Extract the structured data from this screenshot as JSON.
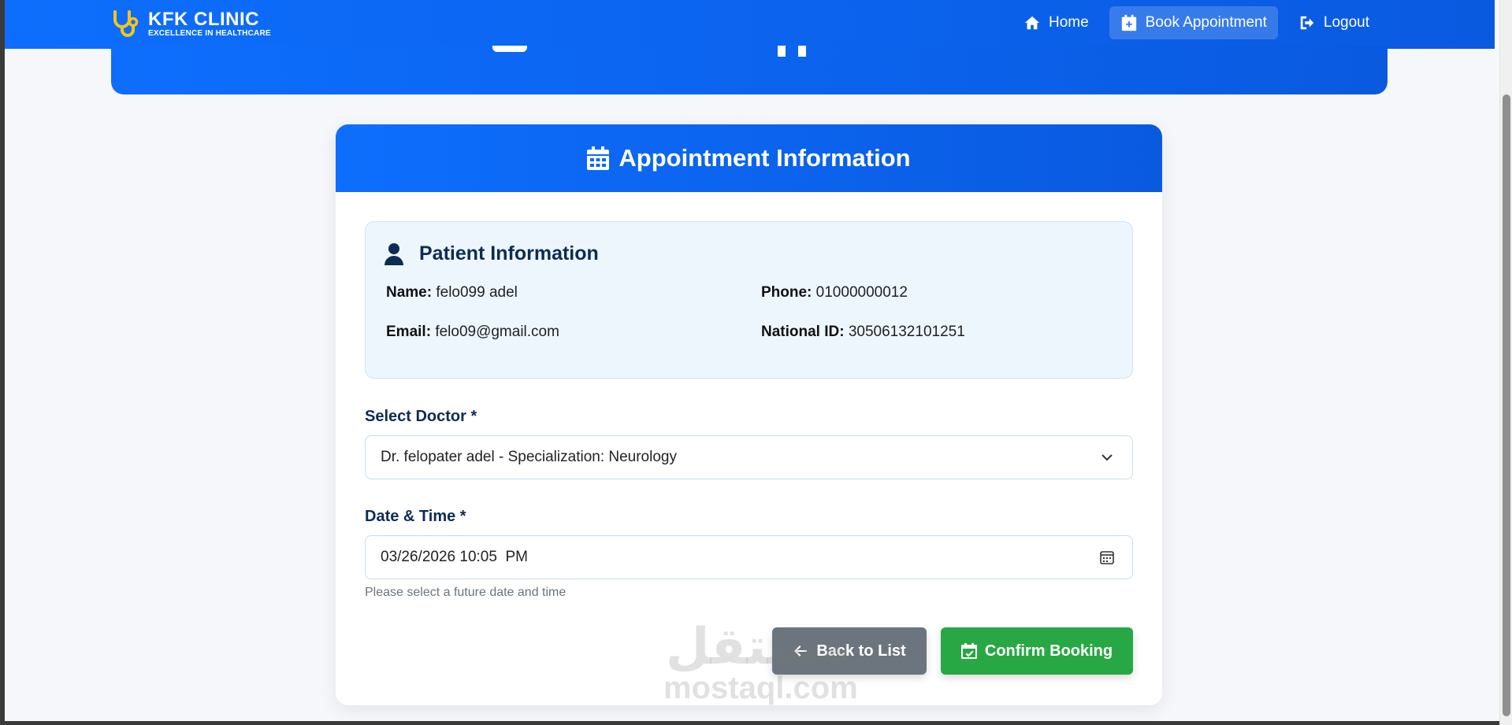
{
  "navbar": {
    "brand_name": "KFK CLINIC",
    "brand_tagline": "EXCELLENCE IN HEALTHCARE",
    "links": [
      {
        "label": "Home",
        "icon": "home-icon",
        "active": false
      },
      {
        "label": "Book Appointment",
        "icon": "calendar-plus-icon",
        "active": true
      },
      {
        "label": "Logout",
        "icon": "logout-icon",
        "active": false
      }
    ]
  },
  "card": {
    "title": "Appointment Information",
    "patient": {
      "title": "Patient Information",
      "name_label": "Name:",
      "name": "felo099 adel",
      "phone_label": "Phone:",
      "phone": "01000000012",
      "email_label": "Email:",
      "email": "felo09@gmail.com",
      "national_id_label": "National ID:",
      "national_id": "30506132101251"
    },
    "doctor_label": "Select Doctor *",
    "doctor_value": "Dr. felopater adel - Specialization: Neurology",
    "datetime_label": "Date & Time *",
    "datetime_value": "03/26/2026 10:05  PM",
    "datetime_hint": "Please select a future date and time",
    "back_label": "Back to List",
    "confirm_label": "Confirm Booking"
  },
  "watermark": {
    "arabic": "مستقل",
    "latin": "mostaql.com"
  },
  "colors": {
    "primary": "#0d6efd",
    "primary_dark": "#0a5ae0",
    "navy": "#0d2c54",
    "success": "#28a745",
    "secondary": "#6c757d",
    "brand_icon": "#f5c518"
  }
}
